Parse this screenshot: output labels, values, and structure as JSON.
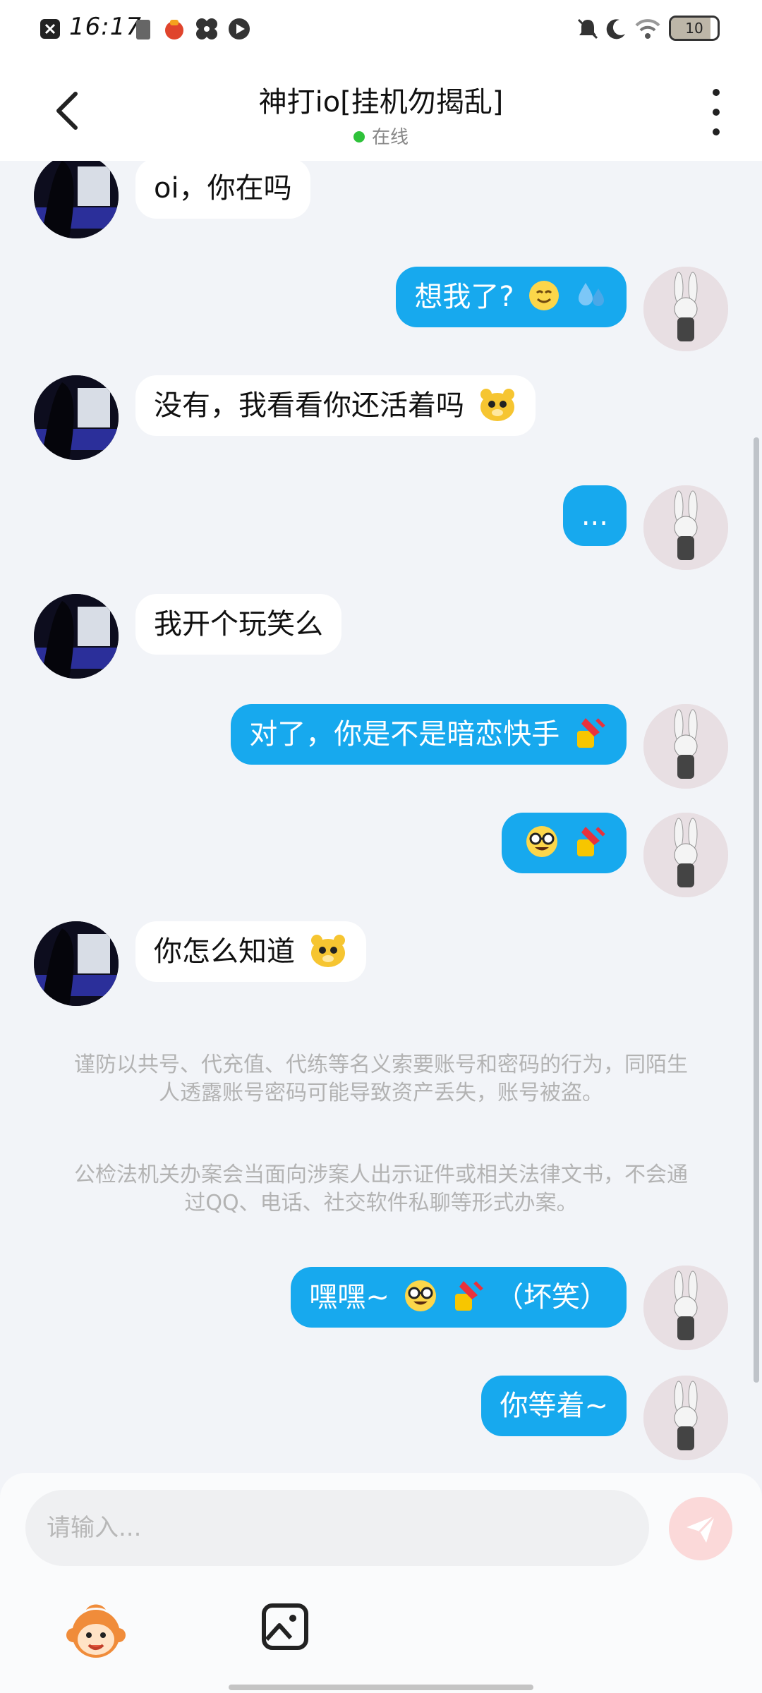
{
  "status_bar": {
    "time": "16:17",
    "battery_level": "10"
  },
  "header": {
    "title": "神打io[挂机勿揭乱]",
    "online_status": "在线"
  },
  "messages": [
    {
      "side": "in",
      "text": "oi，你在吗"
    },
    {
      "side": "out",
      "text": "想我了?",
      "emojis": [
        "smile-emoji",
        "sweat-drops-emoji"
      ]
    },
    {
      "side": "in",
      "text": "没有，我看看你还活着吗",
      "emojis": [
        "yellow-bear-emoji"
      ]
    },
    {
      "side": "out",
      "text": "..."
    },
    {
      "side": "in",
      "text": "我开个玩笑么"
    },
    {
      "side": "out",
      "text": "对了，你是不是暗恋快手",
      "emojis": [
        "nail-polish-emoji"
      ]
    },
    {
      "side": "out",
      "text": "",
      "emojis": [
        "nerd-face-emoji",
        "nail-polish-emoji"
      ]
    },
    {
      "side": "in",
      "text": "你怎么知道",
      "emojis": [
        "yellow-bear-emoji"
      ]
    },
    {
      "side": "out",
      "text": "嘿嘿~",
      "text_after": "（坏笑）",
      "emojis": [
        "nerd-face-emoji",
        "nail-polish-emoji"
      ]
    },
    {
      "side": "out",
      "text": "你等着~"
    }
  ],
  "notice": {
    "paragraph_1": "谨防以共号、代充值、代练等名义索要账号和密码的行为，同陌生人透露账号密码可能导致资产丢失，账号被盗。",
    "paragraph_2": "公检法机关办案会当面向涉案人出示证件或相关法律文书，不会通过QQ、电话、社交软件私聊等形式办案。"
  },
  "input": {
    "placeholder": "请输入..."
  },
  "colors": {
    "outgoing_bubble": "#17a9ee",
    "incoming_bubble": "#ffffff",
    "online_dot": "#2ec23a",
    "send_button": "#fbd9d9"
  }
}
